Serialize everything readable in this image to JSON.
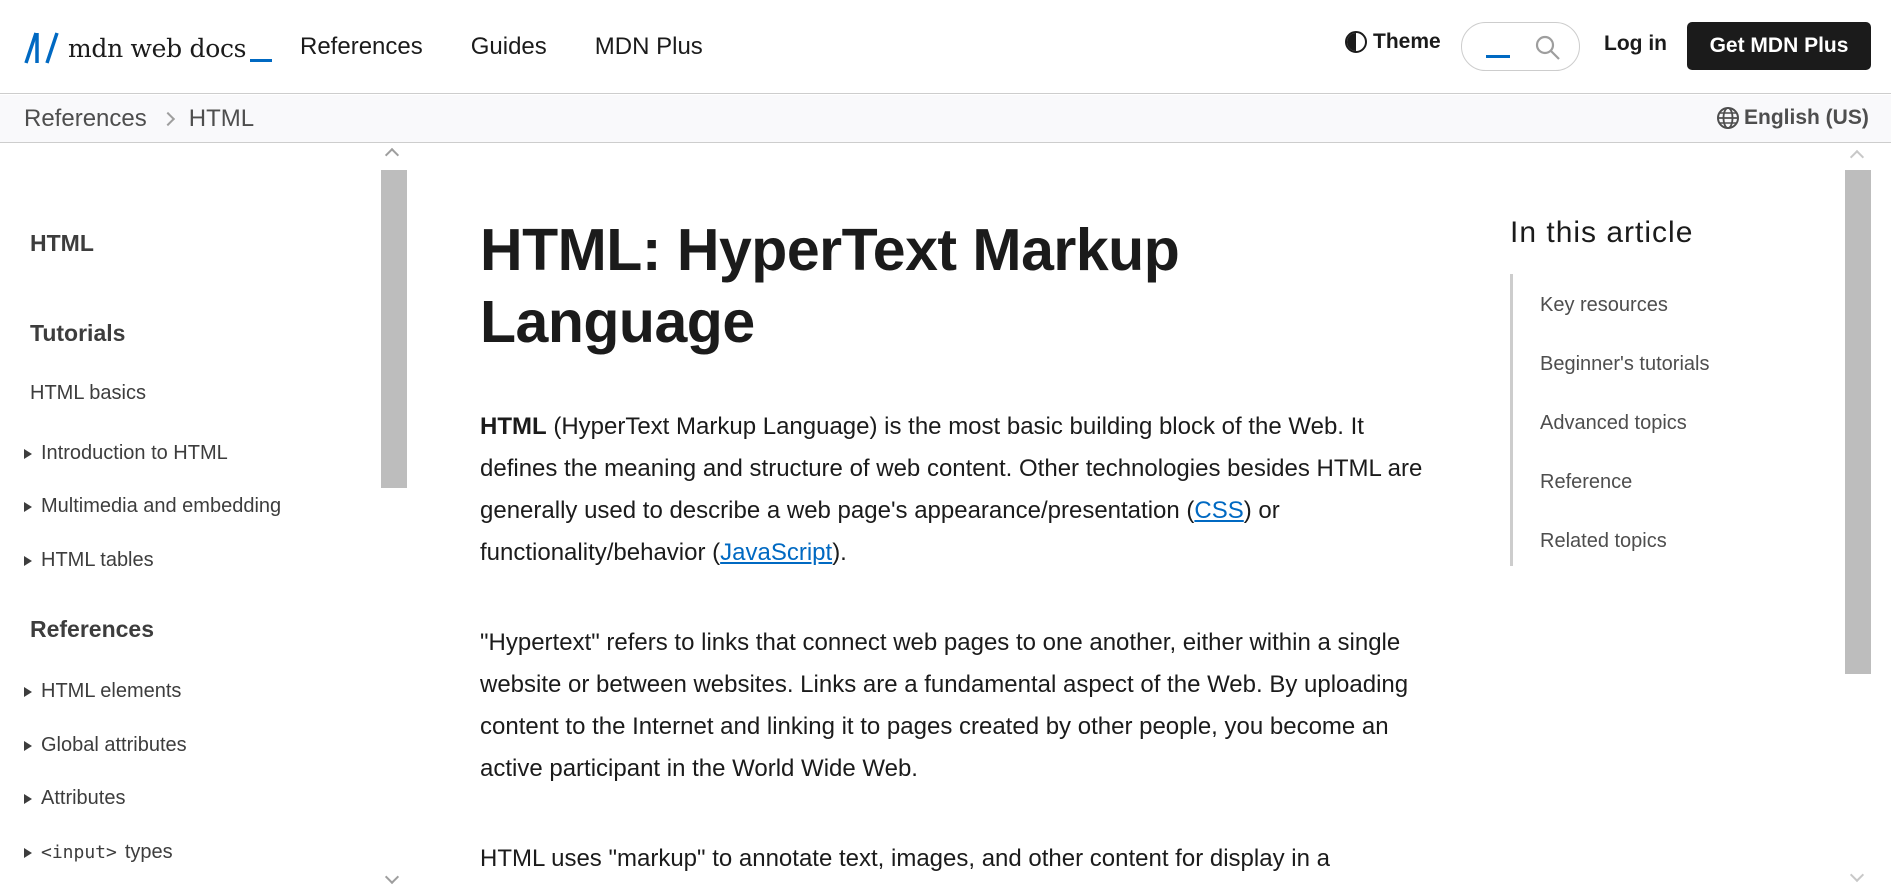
{
  "header": {
    "logo_text": "mdn web docs",
    "nav": [
      "References",
      "Guides",
      "MDN Plus"
    ],
    "theme_label": "Theme",
    "login_label": "Log in",
    "cta_label": "Get MDN Plus",
    "accent": "#0069c2"
  },
  "breadcrumb": {
    "items": [
      "References",
      "HTML"
    ],
    "language": "English (US)"
  },
  "sidebar": {
    "title": "HTML",
    "tutorials_heading": "Tutorials",
    "basics": "HTML basics",
    "tutorial_items": [
      "Introduction to HTML",
      "Multimedia and embedding",
      "HTML tables"
    ],
    "references_heading": "References",
    "reference_items": [
      "HTML elements",
      "Global attributes",
      "Attributes"
    ],
    "input_code": "<input>",
    "input_suffix": "types"
  },
  "article": {
    "title": "HTML: HyperText Markup Language",
    "p1_bold": "HTML",
    "p1_text_a": " (HyperText Markup Language) is the most basic building block of the Web. It defines the meaning and structure of web content. Other technologies besides HTML are generally used to describe a web page's appearance/presentation (",
    "p1_link_css": "CSS",
    "p1_text_b": ") or functionality/behavior (",
    "p1_link_js": "JavaScript",
    "p1_text_c": ").",
    "p2": "\"Hypertext\" refers to links that connect web pages to one another, either within a single website or between websites. Links are a fundamental aspect of the Web. By uploading content to the Internet and linking it to pages created by other people, you become an active participant in the World Wide Web.",
    "p3": "HTML uses \"markup\" to annotate text, images, and other content for display in a"
  },
  "toc": {
    "title": "In this article",
    "items": [
      "Key resources",
      "Beginner's tutorials",
      "Advanced topics",
      "Reference",
      "Related topics"
    ]
  }
}
